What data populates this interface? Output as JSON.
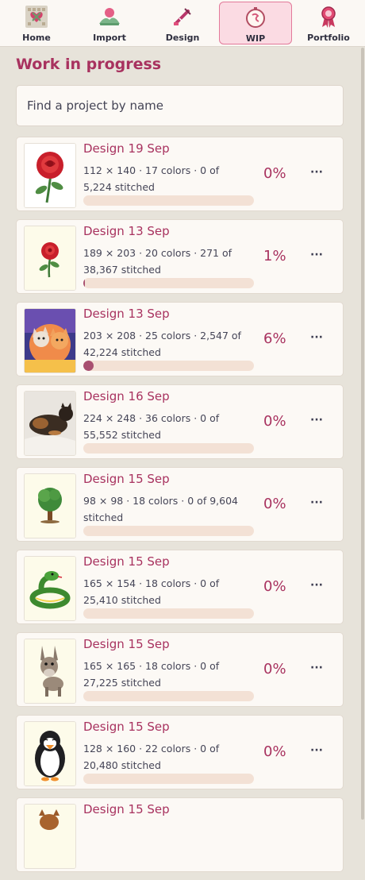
{
  "nav": {
    "items": [
      {
        "label": "Home",
        "icon": "home-grid-icon",
        "active": false
      },
      {
        "label": "Import",
        "icon": "import-hills-icon",
        "active": false
      },
      {
        "label": "Design",
        "icon": "design-needle-icon",
        "active": false
      },
      {
        "label": "WIP",
        "icon": "wip-hoop-icon",
        "active": true
      },
      {
        "label": "Portfolio",
        "icon": "portfolio-ribbon-icon",
        "active": false
      }
    ],
    "active_color": "#fbdbe3"
  },
  "page": {
    "title": "Work in progress"
  },
  "search": {
    "placeholder": "Find a project by name"
  },
  "projects": [
    {
      "title": "Design 19 Sep",
      "meta": "112 × 140 · 17 colors · 0 of 5,224 stitched",
      "percent": "0%",
      "progress": 0,
      "thumbnail": "red-rose",
      "more": "···"
    },
    {
      "title": "Design 13 Sep",
      "meta": "189 × 203 · 20 colors · 271 of 38,367 stitched",
      "percent": "1%",
      "progress": 0.007,
      "thumbnail": "small-red-rose",
      "more": "···"
    },
    {
      "title": "Design 13 Sep",
      "meta": "203 × 208 · 25 colors · 2,547 of 42,224 stitched",
      "percent": "6%",
      "progress": 0.06,
      "thumbnail": "hugging-cats",
      "more": "···"
    },
    {
      "title": "Design 16 Sep",
      "meta": "224 × 248 · 36 colors · 0 of 55,552 stitched",
      "percent": "0%",
      "progress": 0,
      "thumbnail": "tortoiseshell-cat",
      "more": "···"
    },
    {
      "title": "Design 15 Sep",
      "meta": "98 × 98 · 18 colors · 0 of 9,604 stitched",
      "percent": "0%",
      "progress": 0,
      "thumbnail": "green-tree",
      "more": "···"
    },
    {
      "title": "Design 15 Sep",
      "meta": "165 × 154 · 18 colors · 0 of 25,410 stitched",
      "percent": "0%",
      "progress": 0,
      "thumbnail": "green-snake",
      "more": "···"
    },
    {
      "title": "Design 15 Sep",
      "meta": "165 × 165 · 18 colors · 0 of 27,225 stitched",
      "percent": "0%",
      "progress": 0,
      "thumbnail": "donkey",
      "more": "···"
    },
    {
      "title": "Design 15 Sep",
      "meta": "128 × 160 · 22 colors · 0 of 20,480 stitched",
      "percent": "0%",
      "progress": 0,
      "thumbnail": "penguin",
      "more": "···"
    },
    {
      "title": "Design 15 Sep",
      "meta": "",
      "percent": "",
      "progress": 0,
      "thumbnail": "brown-animal",
      "more": ""
    }
  ],
  "colors": {
    "accent": "#a8325f",
    "background": "#e7e3da",
    "card": "#fcf9f5",
    "bar_track": "#f3e1d5",
    "bar_fill": "#a84f70"
  }
}
